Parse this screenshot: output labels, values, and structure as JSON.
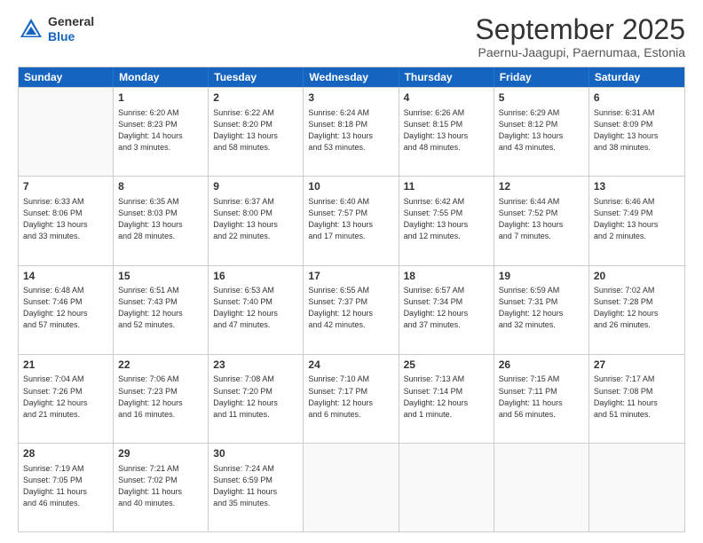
{
  "header": {
    "logo_general": "General",
    "logo_blue": "Blue",
    "month_title": "September 2025",
    "subtitle": "Paernu-Jaagupi, Paernumaa, Estonia"
  },
  "days_of_week": [
    "Sunday",
    "Monday",
    "Tuesday",
    "Wednesday",
    "Thursday",
    "Friday",
    "Saturday"
  ],
  "rows": [
    [
      {
        "day": "",
        "text": ""
      },
      {
        "day": "1",
        "text": "Sunrise: 6:20 AM\nSunset: 8:23 PM\nDaylight: 14 hours\nand 3 minutes."
      },
      {
        "day": "2",
        "text": "Sunrise: 6:22 AM\nSunset: 8:20 PM\nDaylight: 13 hours\nand 58 minutes."
      },
      {
        "day": "3",
        "text": "Sunrise: 6:24 AM\nSunset: 8:18 PM\nDaylight: 13 hours\nand 53 minutes."
      },
      {
        "day": "4",
        "text": "Sunrise: 6:26 AM\nSunset: 8:15 PM\nDaylight: 13 hours\nand 48 minutes."
      },
      {
        "day": "5",
        "text": "Sunrise: 6:29 AM\nSunset: 8:12 PM\nDaylight: 13 hours\nand 43 minutes."
      },
      {
        "day": "6",
        "text": "Sunrise: 6:31 AM\nSunset: 8:09 PM\nDaylight: 13 hours\nand 38 minutes."
      }
    ],
    [
      {
        "day": "7",
        "text": "Sunrise: 6:33 AM\nSunset: 8:06 PM\nDaylight: 13 hours\nand 33 minutes."
      },
      {
        "day": "8",
        "text": "Sunrise: 6:35 AM\nSunset: 8:03 PM\nDaylight: 13 hours\nand 28 minutes."
      },
      {
        "day": "9",
        "text": "Sunrise: 6:37 AM\nSunset: 8:00 PM\nDaylight: 13 hours\nand 22 minutes."
      },
      {
        "day": "10",
        "text": "Sunrise: 6:40 AM\nSunset: 7:57 PM\nDaylight: 13 hours\nand 17 minutes."
      },
      {
        "day": "11",
        "text": "Sunrise: 6:42 AM\nSunset: 7:55 PM\nDaylight: 13 hours\nand 12 minutes."
      },
      {
        "day": "12",
        "text": "Sunrise: 6:44 AM\nSunset: 7:52 PM\nDaylight: 13 hours\nand 7 minutes."
      },
      {
        "day": "13",
        "text": "Sunrise: 6:46 AM\nSunset: 7:49 PM\nDaylight: 13 hours\nand 2 minutes."
      }
    ],
    [
      {
        "day": "14",
        "text": "Sunrise: 6:48 AM\nSunset: 7:46 PM\nDaylight: 12 hours\nand 57 minutes."
      },
      {
        "day": "15",
        "text": "Sunrise: 6:51 AM\nSunset: 7:43 PM\nDaylight: 12 hours\nand 52 minutes."
      },
      {
        "day": "16",
        "text": "Sunrise: 6:53 AM\nSunset: 7:40 PM\nDaylight: 12 hours\nand 47 minutes."
      },
      {
        "day": "17",
        "text": "Sunrise: 6:55 AM\nSunset: 7:37 PM\nDaylight: 12 hours\nand 42 minutes."
      },
      {
        "day": "18",
        "text": "Sunrise: 6:57 AM\nSunset: 7:34 PM\nDaylight: 12 hours\nand 37 minutes."
      },
      {
        "day": "19",
        "text": "Sunrise: 6:59 AM\nSunset: 7:31 PM\nDaylight: 12 hours\nand 32 minutes."
      },
      {
        "day": "20",
        "text": "Sunrise: 7:02 AM\nSunset: 7:28 PM\nDaylight: 12 hours\nand 26 minutes."
      }
    ],
    [
      {
        "day": "21",
        "text": "Sunrise: 7:04 AM\nSunset: 7:26 PM\nDaylight: 12 hours\nand 21 minutes."
      },
      {
        "day": "22",
        "text": "Sunrise: 7:06 AM\nSunset: 7:23 PM\nDaylight: 12 hours\nand 16 minutes."
      },
      {
        "day": "23",
        "text": "Sunrise: 7:08 AM\nSunset: 7:20 PM\nDaylight: 12 hours\nand 11 minutes."
      },
      {
        "day": "24",
        "text": "Sunrise: 7:10 AM\nSunset: 7:17 PM\nDaylight: 12 hours\nand 6 minutes."
      },
      {
        "day": "25",
        "text": "Sunrise: 7:13 AM\nSunset: 7:14 PM\nDaylight: 12 hours\nand 1 minute."
      },
      {
        "day": "26",
        "text": "Sunrise: 7:15 AM\nSunset: 7:11 PM\nDaylight: 11 hours\nand 56 minutes."
      },
      {
        "day": "27",
        "text": "Sunrise: 7:17 AM\nSunset: 7:08 PM\nDaylight: 11 hours\nand 51 minutes."
      }
    ],
    [
      {
        "day": "28",
        "text": "Sunrise: 7:19 AM\nSunset: 7:05 PM\nDaylight: 11 hours\nand 46 minutes."
      },
      {
        "day": "29",
        "text": "Sunrise: 7:21 AM\nSunset: 7:02 PM\nDaylight: 11 hours\nand 40 minutes."
      },
      {
        "day": "30",
        "text": "Sunrise: 7:24 AM\nSunset: 6:59 PM\nDaylight: 11 hours\nand 35 minutes."
      },
      {
        "day": "",
        "text": ""
      },
      {
        "day": "",
        "text": ""
      },
      {
        "day": "",
        "text": ""
      },
      {
        "day": "",
        "text": ""
      }
    ]
  ]
}
